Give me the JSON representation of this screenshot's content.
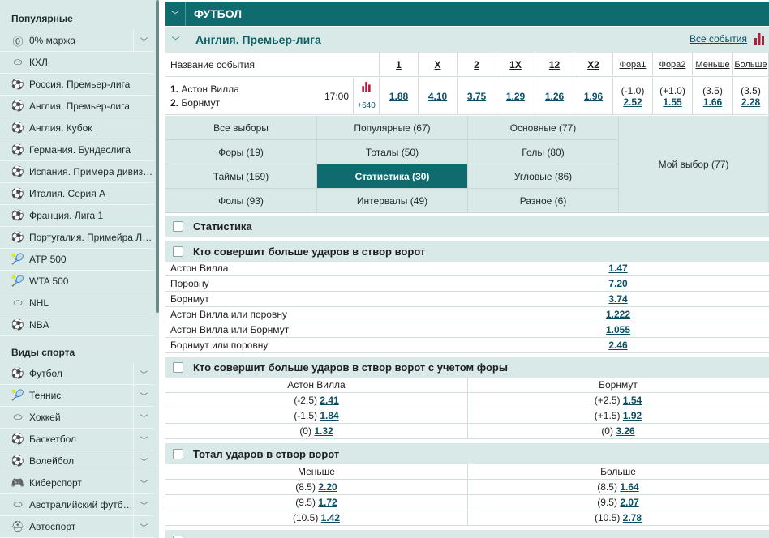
{
  "sidebar": {
    "popular_title": "Популярные",
    "popular": [
      {
        "label": "0% маржа",
        "icon": "zero-margin-icon",
        "glyph": "⓪",
        "chevron": true
      },
      {
        "label": "КХЛ",
        "icon": "hockey-puck-icon",
        "glyph": "⬭",
        "chevron": false
      },
      {
        "label": "Россия. Премьер-лига",
        "icon": "soccer-ball-icon",
        "glyph": "⚽",
        "chevron": false
      },
      {
        "label": "Англия. Премьер-лига",
        "icon": "soccer-ball-icon",
        "glyph": "⚽",
        "chevron": false
      },
      {
        "label": "Англия. Кубок",
        "icon": "soccer-ball-icon",
        "glyph": "⚽",
        "chevron": false
      },
      {
        "label": "Германия. Бундеслига",
        "icon": "soccer-ball-icon",
        "glyph": "⚽",
        "chevron": false
      },
      {
        "label": "Испания. Примера дивизион",
        "icon": "soccer-ball-icon",
        "glyph": "⚽",
        "chevron": false
      },
      {
        "label": "Италия. Серия А",
        "icon": "soccer-ball-icon",
        "glyph": "⚽",
        "chevron": false
      },
      {
        "label": "Франция. Лига 1",
        "icon": "soccer-ball-icon",
        "glyph": "⚽",
        "chevron": false
      },
      {
        "label": "Португалия. Примейра Лига",
        "icon": "soccer-ball-icon",
        "glyph": "⚽",
        "chevron": false
      },
      {
        "label": "ATP 500",
        "icon": "tennis-racket-icon",
        "glyph": "🎾",
        "chevron": false
      },
      {
        "label": "WTA 500",
        "icon": "tennis-racket-icon",
        "glyph": "🎾",
        "chevron": false
      },
      {
        "label": "NHL",
        "icon": "hockey-puck-icon",
        "glyph": "⬭",
        "chevron": false
      },
      {
        "label": "NBA",
        "icon": "basketball-icon",
        "glyph": "⚽",
        "chevron": false
      }
    ],
    "sports_title": "Виды спорта",
    "sports": [
      {
        "label": "Футбол",
        "icon": "soccer-ball-icon",
        "glyph": "⚽",
        "chevron": true
      },
      {
        "label": "Теннис",
        "icon": "tennis-racket-icon",
        "glyph": "🎾",
        "chevron": true
      },
      {
        "label": "Хоккей",
        "icon": "hockey-puck-icon",
        "glyph": "⬭",
        "chevron": true
      },
      {
        "label": "Баскетбол",
        "icon": "basketball-icon",
        "glyph": "⚽",
        "chevron": true
      },
      {
        "label": "Волейбол",
        "icon": "volleyball-icon",
        "glyph": "⚽",
        "chevron": true
      },
      {
        "label": "Киберспорт",
        "icon": "gamepad-icon",
        "glyph": "🎮",
        "chevron": true
      },
      {
        "label": "Австралийский футбол",
        "icon": "aussie-ball-icon",
        "glyph": "⬭",
        "chevron": true
      },
      {
        "label": "Автоспорт",
        "icon": "racing-helmet-icon",
        "glyph": "⛑",
        "chevron": true
      }
    ]
  },
  "header": {
    "sport": "ФУТБОЛ",
    "league": "Англия. Премьер-лига",
    "all_events": "Все события",
    "toggle_glyph": "﹀"
  },
  "table": {
    "event_col": "Название события",
    "columns": [
      "1",
      "X",
      "2",
      "1X",
      "12",
      "X2",
      "Фора1",
      "Фора2",
      "Меньше",
      "Больше"
    ],
    "event": {
      "team1_num": "1.",
      "team1": "Астон Вилла",
      "team2_num": "2.",
      "team2": "Борнмут",
      "time": "17:00",
      "more": "+640",
      "odds": [
        {
          "top": "",
          "value": "1.88"
        },
        {
          "top": "",
          "value": "4.10"
        },
        {
          "top": "",
          "value": "3.75"
        },
        {
          "top": "",
          "value": "1.29"
        },
        {
          "top": "",
          "value": "1.26"
        },
        {
          "top": "",
          "value": "1.96"
        },
        {
          "top": "(-1.0)",
          "value": "2.52"
        },
        {
          "top": "(+1.0)",
          "value": "1.55"
        },
        {
          "top": "(3.5)",
          "value": "1.66"
        },
        {
          "top": "(3.5)",
          "value": "2.28"
        }
      ]
    }
  },
  "tabs": {
    "rows": [
      [
        "Все выборы",
        "Популярные (67)",
        "Основные (77)"
      ],
      [
        "Форы (19)",
        "Тоталы (50)",
        "Голы (80)"
      ],
      [
        "Таймы (159)",
        "Статистика (30)",
        "Угловые (86)"
      ],
      [
        "Фолы (93)",
        "Интервалы (49)",
        "Разное (6)"
      ]
    ],
    "my_choice": "Мой выбор (77)",
    "active": "Статистика (30)"
  },
  "sections": {
    "stats_title": "Статистика",
    "shots_title": "Кто совершит больше ударов в створ ворот",
    "shots_rows": [
      {
        "name": "Астон Вилла",
        "value": "1.47"
      },
      {
        "name": "Поровну",
        "value": "7.20"
      },
      {
        "name": "Борнмут",
        "value": "3.74"
      },
      {
        "name": "Астон Вилла или поровну",
        "value": "1.222"
      },
      {
        "name": "Астон Вилла или Борнмут",
        "value": "1.055"
      },
      {
        "name": "Борнмут или поровну",
        "value": "2.46"
      }
    ],
    "handicap_title": "Кто совершит больше ударов в створ ворот с учетом форы",
    "handicap_headers": [
      "Астон Вилла",
      "Борнмут"
    ],
    "handicap_rows": [
      {
        "l_line": "(-2.5)",
        "l_val": "2.41",
        "r_line": "(+2.5)",
        "r_val": "1.54"
      },
      {
        "l_line": "(-1.5)",
        "l_val": "1.84",
        "r_line": "(+1.5)",
        "r_val": "1.92"
      },
      {
        "l_line": "(0)",
        "l_val": "1.32",
        "r_line": "(0)",
        "r_val": "3.26"
      }
    ],
    "total_title": "Тотал ударов в створ ворот",
    "total_headers": [
      "Меньше",
      "Больше"
    ],
    "total_rows": [
      {
        "l_line": "(8.5)",
        "l_val": "2.20",
        "r_line": "(8.5)",
        "r_val": "1.64"
      },
      {
        "l_line": "(9.5)",
        "l_val": "1.72",
        "r_line": "(9.5)",
        "r_val": "2.07"
      },
      {
        "l_line": "(10.5)",
        "l_val": "1.42",
        "r_line": "(10.5)",
        "r_val": "2.78"
      }
    ]
  },
  "colors": {
    "accent": "#0f6b6e",
    "panel": "#d8e9e8",
    "link": "#0c4f64"
  }
}
